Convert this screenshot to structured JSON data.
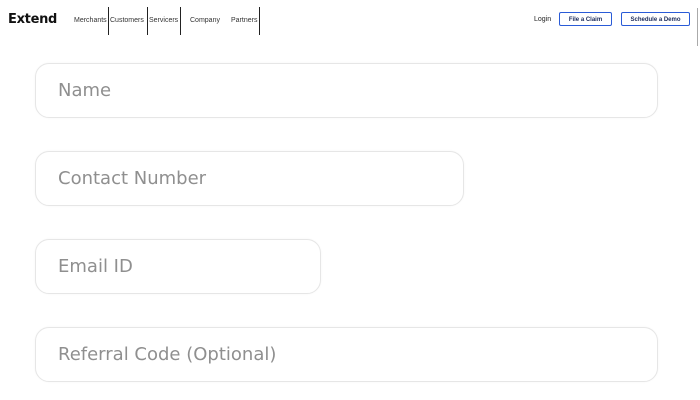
{
  "header": {
    "logo": "Extend",
    "nav": [
      "Merchants",
      "Customers",
      "Servicers",
      "Company",
      "Partners"
    ],
    "login": "Login",
    "claim_button": "File a Claim",
    "demo_button": "Schedule a Demo",
    "button_border_color": "#2a5bd7"
  },
  "form": {
    "name_placeholder": "Name",
    "contact_placeholder": "Contact Number",
    "email_placeholder": "Email ID",
    "referral_placeholder": "Referral Code (Optional)"
  }
}
